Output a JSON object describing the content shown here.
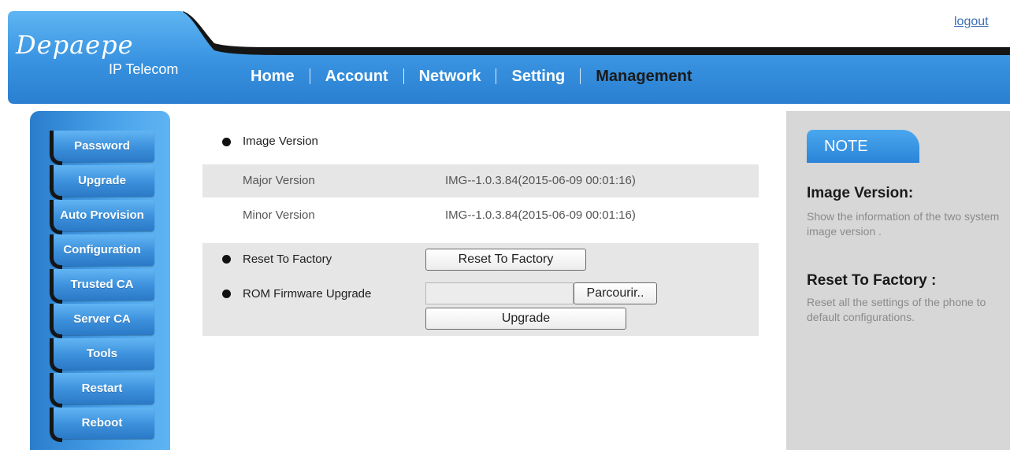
{
  "app": {
    "brand_script": "Depaepe",
    "brand_sub": "IP Telecom",
    "logout_label": "logout"
  },
  "nav": {
    "items": [
      {
        "label": "Home"
      },
      {
        "label": "Account"
      },
      {
        "label": "Network"
      },
      {
        "label": "Setting"
      },
      {
        "label": "Management"
      }
    ],
    "active": "Management"
  },
  "sidebar": {
    "items": [
      {
        "label": "Password"
      },
      {
        "label": "Upgrade"
      },
      {
        "label": "Auto Provision"
      },
      {
        "label": "Configuration"
      },
      {
        "label": "Trusted CA"
      },
      {
        "label": "Server CA"
      },
      {
        "label": "Tools"
      },
      {
        "label": "Restart"
      },
      {
        "label": "Reboot"
      }
    ]
  },
  "main": {
    "image_version": {
      "title": "Image Version",
      "major_label": "Major Version",
      "major_value": "IMG--1.0.3.84(2015-06-09 00:01:16)",
      "minor_label": "Minor Version",
      "minor_value": "IMG--1.0.3.84(2015-06-09 00:01:16)"
    },
    "reset": {
      "title": "Reset To Factory",
      "button_label": "Reset To Factory"
    },
    "rom": {
      "title": "ROM Firmware Upgrade",
      "file_value": "",
      "browse_label": "Parcourir..",
      "upgrade_label": "Upgrade"
    }
  },
  "note": {
    "tab_label": "NOTE",
    "sections": [
      {
        "heading": "Image Version:",
        "text": "Show the information of the two system image version ."
      },
      {
        "heading": "Reset To Factory :",
        "text": "Reset all the settings of the phone to default configurations."
      }
    ]
  },
  "colors": {
    "brand_blue": "#2b84d8",
    "header_dark": "#151515",
    "note_panel": "#d7d7d7",
    "row_gray": "#e6e6e6",
    "link": "#3c6fb6"
  }
}
